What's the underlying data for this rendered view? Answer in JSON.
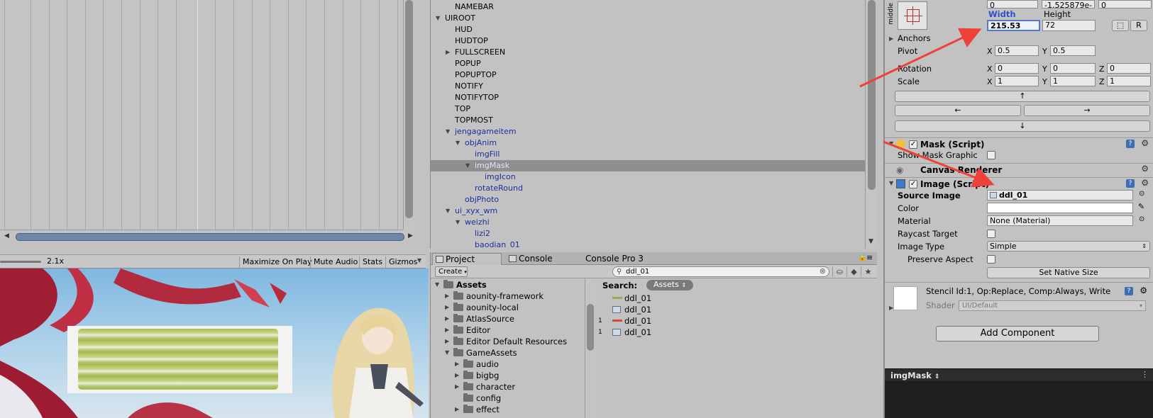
{
  "colors": {
    "arrow": "#f0403a",
    "accent": "#1b2f9e",
    "selection": "#8f8f8f"
  },
  "game_toolbar": {
    "zoom": "2.1x",
    "buttons": [
      "Maximize On Play",
      "Mute Audio",
      "Stats",
      "Gizmos"
    ]
  },
  "hierarchy": {
    "items": [
      {
        "label": "NAMEBAR",
        "depth": 1,
        "fold": "",
        "blue": false
      },
      {
        "label": "UIROOT",
        "depth": 0,
        "fold": "open",
        "blue": false
      },
      {
        "label": "HUD",
        "depth": 1,
        "fold": "",
        "blue": false
      },
      {
        "label": "HUDTOP",
        "depth": 1,
        "fold": "",
        "blue": false
      },
      {
        "label": "FULLSCREEN",
        "depth": 1,
        "fold": "closed",
        "blue": false
      },
      {
        "label": "POPUP",
        "depth": 1,
        "fold": "",
        "blue": false
      },
      {
        "label": "POPUPTOP",
        "depth": 1,
        "fold": "",
        "blue": false
      },
      {
        "label": "NOTIFY",
        "depth": 1,
        "fold": "",
        "blue": false
      },
      {
        "label": "NOTIFYTOP",
        "depth": 1,
        "fold": "",
        "blue": false
      },
      {
        "label": "TOP",
        "depth": 1,
        "fold": "",
        "blue": false
      },
      {
        "label": "TOPMOST",
        "depth": 1,
        "fold": "",
        "blue": false
      },
      {
        "label": "jengagameitem",
        "depth": 1,
        "fold": "open",
        "blue": true
      },
      {
        "label": "objAnim",
        "depth": 2,
        "fold": "open",
        "blue": true
      },
      {
        "label": "imgFill",
        "depth": 3,
        "fold": "",
        "blue": true
      },
      {
        "label": "imgMask",
        "depth": 3,
        "fold": "open",
        "blue": true,
        "selected": true
      },
      {
        "label": "imgIcon",
        "depth": 4,
        "fold": "",
        "blue": true
      },
      {
        "label": "rotateRound",
        "depth": 3,
        "fold": "",
        "blue": true
      },
      {
        "label": "objPhoto",
        "depth": 2,
        "fold": "",
        "blue": true
      },
      {
        "label": "ui_xyx_wm",
        "depth": 1,
        "fold": "open",
        "blue": true
      },
      {
        "label": "weizhi",
        "depth": 2,
        "fold": "open",
        "blue": true
      },
      {
        "label": "lizi2",
        "depth": 3,
        "fold": "",
        "blue": true
      },
      {
        "label": "baodian_01",
        "depth": 3,
        "fold": "",
        "blue": true
      }
    ]
  },
  "project": {
    "tabs": [
      "Project",
      "Console",
      "Console Pro 3"
    ],
    "create_label": "Create",
    "search_value": "ddl_01",
    "tree": [
      {
        "label": "Assets",
        "depth": 0,
        "fold": "open",
        "bold": true
      },
      {
        "label": "aounity-framework",
        "depth": 1,
        "fold": "closed"
      },
      {
        "label": "aounity-local",
        "depth": 1,
        "fold": "closed"
      },
      {
        "label": "AtlasSource",
        "depth": 1,
        "fold": "closed"
      },
      {
        "label": "Editor",
        "depth": 1,
        "fold": "closed"
      },
      {
        "label": "Editor Default Resources",
        "depth": 1,
        "fold": "closed"
      },
      {
        "label": "GameAssets",
        "depth": 1,
        "fold": "open"
      },
      {
        "label": "audio",
        "depth": 2,
        "fold": "closed"
      },
      {
        "label": "bigbg",
        "depth": 2,
        "fold": "closed"
      },
      {
        "label": "character",
        "depth": 2,
        "fold": "closed"
      },
      {
        "label": "config",
        "depth": 2,
        "fold": ""
      },
      {
        "label": "effect",
        "depth": 2,
        "fold": "closed"
      }
    ],
    "search_label": "Search:",
    "search_scope": "Assets",
    "results": [
      {
        "label": "ddl_01",
        "icon": "sprite-bar-icon",
        "num": ""
      },
      {
        "label": "ddl_01",
        "icon": "texture-icon",
        "num": ""
      },
      {
        "label": "ddl_01",
        "icon": "sprite-bar-red-icon",
        "num": "1"
      },
      {
        "label": "ddl_01",
        "icon": "texture-icon",
        "num": "1"
      }
    ]
  },
  "inspector": {
    "anchor_label": "middle",
    "top_values": [
      "0",
      "-1.525879e-",
      "0"
    ],
    "width_label": "Width",
    "height_label": "Height",
    "width_value": "215.53",
    "height_value": "72",
    "blueprint_btn": "⬚",
    "raw_btn": "R",
    "anchors_label": "Anchors",
    "pivot_label": "Pivot",
    "pivot": {
      "x": "0.5",
      "y": "0.5"
    },
    "rotation_label": "Rotation",
    "rotation": {
      "x": "0",
      "y": "0",
      "z": "0"
    },
    "scale_label": "Scale",
    "scale": {
      "x": "1",
      "y": "1",
      "z": "1"
    },
    "arrow_up": "↑",
    "arrow_left": "←",
    "arrow_right": "→",
    "arrow_down": "↓",
    "mask_title": "Mask (Script)",
    "show_mask_label": "Show Mask Graphic",
    "canvas_renderer_title": "Canvas Renderer",
    "image_title": "Image (Script)",
    "source_image_label": "Source Image",
    "source_image_value": "ddl_01",
    "color_label": "Color",
    "material_label": "Material",
    "material_value": "None (Material)",
    "raycast_label": "Raycast Target",
    "image_type_label": "Image Type",
    "image_type_value": "Simple",
    "preserve_label": "Preserve Aspect",
    "set_native_label": "Set Native Size",
    "stencil_text": "Stencil Id:1, Op:Replace, Comp:Always, Write",
    "shader_label": "Shader",
    "shader_value": "UI/Default",
    "add_component_label": "Add Component",
    "preview_label": "imgMask"
  }
}
